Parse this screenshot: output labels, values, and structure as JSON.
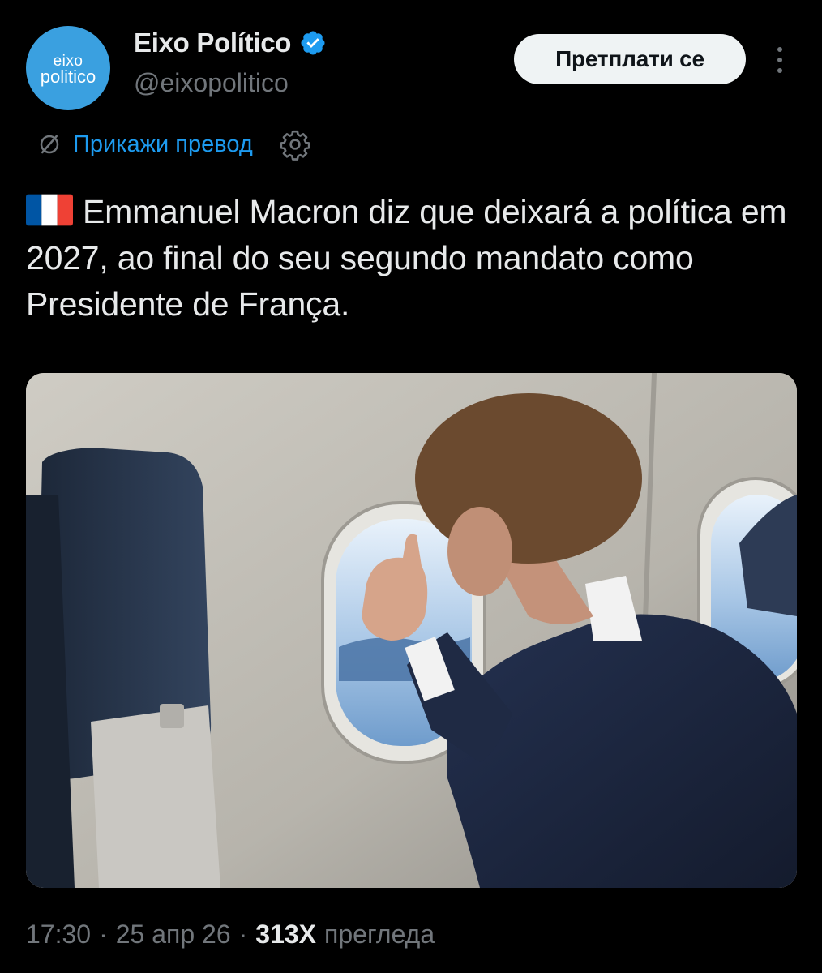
{
  "author": {
    "display_name": "Eixo Político",
    "handle": "@eixopolitico",
    "avatar_line1": "eixo",
    "avatar_line2": "politico",
    "verified": true
  },
  "header": {
    "subscribe_label": "Претплати се",
    "more_icon": "more-vertical-icon"
  },
  "translate": {
    "label": "Прикажи превод",
    "icon": "translate-icon",
    "settings_icon": "gear-icon"
  },
  "tweet": {
    "flag": "france-flag",
    "text": "Emmanuel Macron diz que deixará a política em 2027, ao final do seu segundo mandato como Presidente de França."
  },
  "footer": {
    "time": "17:30",
    "date": "25 апр 26",
    "separator": "·",
    "views_count": "313Х",
    "views_label": "прегледа"
  },
  "colors": {
    "background": "#000000",
    "text_primary": "#e7e9ea",
    "text_secondary": "#71767b",
    "link": "#1d9bf0",
    "verified": "#1d9bf0",
    "avatar_bg": "#3aa0e0",
    "button_bg": "#eff3f4"
  }
}
